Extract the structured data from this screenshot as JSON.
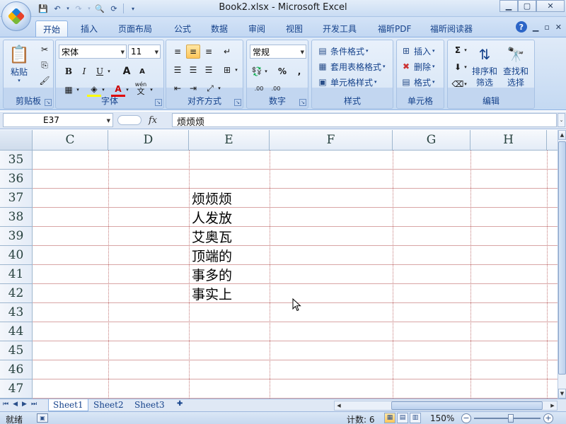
{
  "window": {
    "title": "Book2.xlsx - Microsoft Excel"
  },
  "ribbon": {
    "tabs": [
      {
        "label": "开始",
        "active": true
      },
      {
        "label": "插入"
      },
      {
        "label": "页面布局"
      },
      {
        "label": "公式"
      },
      {
        "label": "数据"
      },
      {
        "label": "审阅"
      },
      {
        "label": "视图"
      },
      {
        "label": "开发工具"
      },
      {
        "label": "福昕PDF"
      },
      {
        "label": "福昕阅读器"
      }
    ],
    "groups": {
      "clipboard": {
        "label": "剪贴板",
        "paste": "粘贴"
      },
      "font": {
        "label": "字体",
        "name": "宋体",
        "size": "11",
        "bold": "B",
        "italic": "I",
        "underline": "U",
        "grow": "A",
        "shrink": "A",
        "phonetic": "wén",
        "phonetic2": "文"
      },
      "alignment": {
        "label": "对齐方式"
      },
      "number": {
        "label": "数字",
        "format": "常规",
        "percent": "%",
        "comma": ",",
        "inc_dec": ".00",
        "dec_dec": ".00"
      },
      "styles": {
        "label": "样式",
        "conditional": "条件格式",
        "table": "套用表格格式",
        "cell": "单元格样式"
      },
      "cells": {
        "label": "单元格",
        "insert": "插入",
        "delete": "删除",
        "format": "格式"
      },
      "editing": {
        "label": "编辑",
        "sort": "排序和",
        "sort2": "筛选",
        "find": "查找和",
        "find2": "选择"
      }
    }
  },
  "formula_bar": {
    "name_box": "E37",
    "fx": "fx",
    "content": "烦烦烦"
  },
  "grid": {
    "columns": [
      "C",
      "D",
      "E",
      "F",
      "G",
      "H"
    ],
    "rows": [
      "35",
      "36",
      "37",
      "38",
      "39",
      "40",
      "41",
      "42",
      "43",
      "44",
      "45",
      "46",
      "47"
    ],
    "cells_e": {
      "37": "烦烦烦",
      "38": "人发放",
      "39": "艾奥瓦",
      "40": "顶端的",
      "41": "事多的",
      "42": "事实上"
    }
  },
  "sheets": [
    "Sheet1",
    "Sheet2",
    "Sheet3"
  ],
  "status": {
    "ready": "就绪",
    "count": "计数: 6",
    "zoom": "150%"
  }
}
